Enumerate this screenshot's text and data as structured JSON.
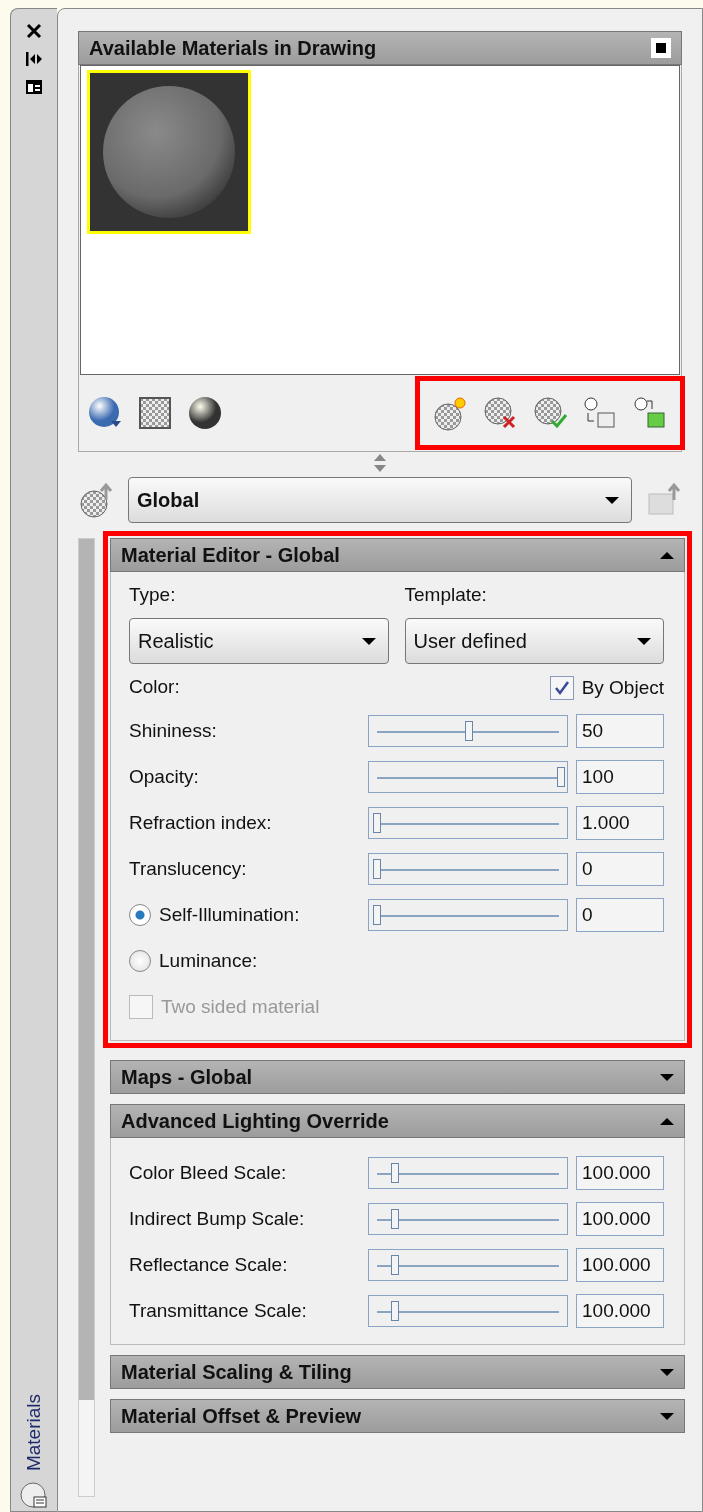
{
  "side_strip": {
    "label": "Materials"
  },
  "materials_panel": {
    "title": "Available Materials in Drawing",
    "materials": [
      {
        "kind": "picture",
        "selected": true
      }
    ],
    "toolbar": {
      "highlighted": true
    }
  },
  "material_select": {
    "value": "Global"
  },
  "sections": [
    {
      "title": "Material Editor - Global",
      "expanded": true,
      "highlighted": true,
      "type_label": "Type:",
      "type_value": "Realistic",
      "template_label": "Template:",
      "template_value": "User defined",
      "color_label": "Color:",
      "by_object": {
        "label": "By Object",
        "checked": true
      },
      "rows": [
        {
          "kind": "slider",
          "label": "Shininess:",
          "level": 0.5,
          "value": "50"
        },
        {
          "kind": "slider",
          "label": "Opacity:",
          "level": 1,
          "value": "100"
        },
        {
          "kind": "slider",
          "label": "Refraction index:",
          "level": 0,
          "value": "1.000"
        },
        {
          "kind": "slider",
          "label": "Translucency:",
          "level": 0,
          "value": "0"
        },
        {
          "kind": "radio_slider",
          "label": "Self-Illumination:",
          "selected": true,
          "level": 0,
          "value": "0"
        },
        {
          "kind": "radio",
          "label": "Luminance:",
          "selected": false
        },
        {
          "kind": "checkbox",
          "label": "Two sided material",
          "checked": false,
          "disabled": true
        }
      ]
    },
    {
      "title": "Maps - Global",
      "expanded": false,
      "highlighted": false
    },
    {
      "title": "Advanced Lighting Override",
      "expanded": true,
      "highlighted": false,
      "rows": [
        {
          "kind": "slider",
          "label": "Color Bleed Scale:",
          "level": 0.1,
          "value": "100.000"
        },
        {
          "kind": "slider",
          "label": "Indirect Bump Scale:",
          "level": 0.1,
          "value": "100.000"
        },
        {
          "kind": "slider",
          "label": "Reflectance Scale:",
          "level": 0.1,
          "value": "100.000"
        },
        {
          "kind": "slider",
          "label": "Transmittance Scale:",
          "level": 0.1,
          "value": "100.000"
        }
      ]
    },
    {
      "title": "Material Scaling & Tiling",
      "expanded": false,
      "highlighted": false
    },
    {
      "title": "Material Offset & Preview",
      "expanded": false,
      "highlighted": false
    }
  ]
}
